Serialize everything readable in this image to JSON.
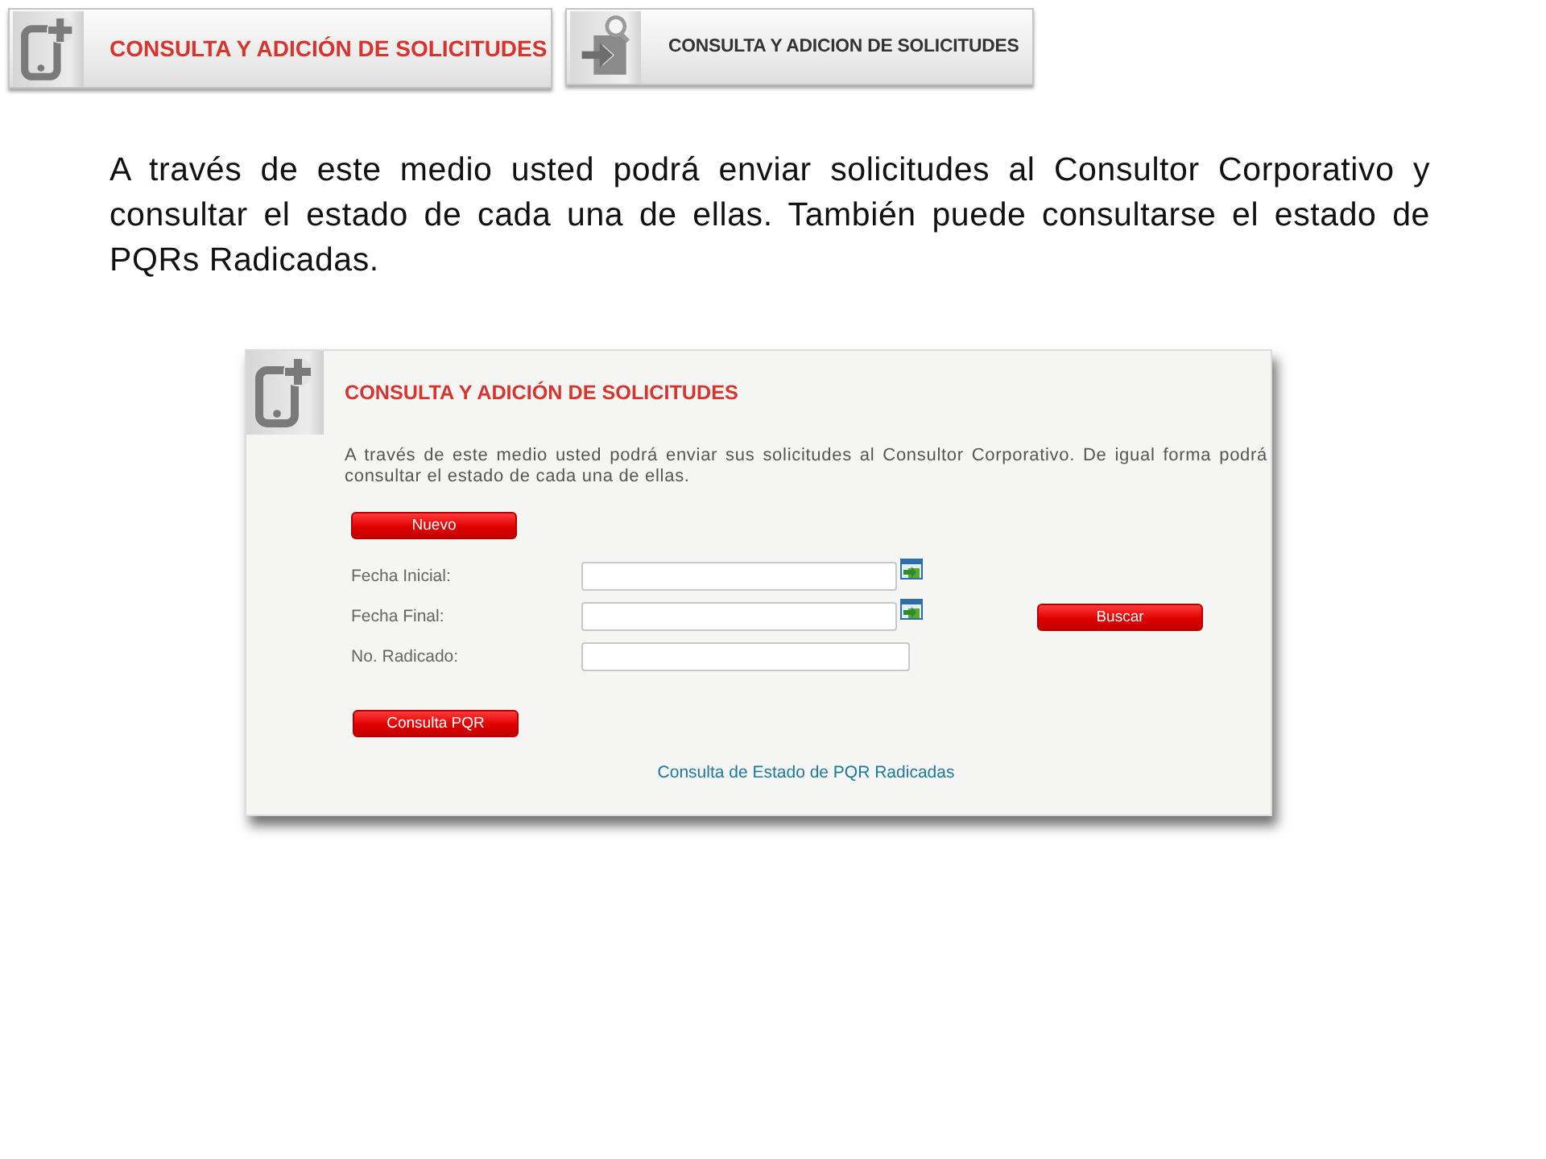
{
  "banners": [
    {
      "kind": "add",
      "title": "CONSULTA Y ADICIÓN DE SOLICITUDES"
    },
    {
      "kind": "search",
      "title": "CONSULTA Y ADICION DE SOLICITUDES"
    }
  ],
  "intro": "A través de este medio usted podrá enviar solicitudes al Consultor Corporativo y consultar el estado de cada una de ellas. También puede consultarse el estado de PQRs Radicadas.",
  "screenshot": {
    "title": "CONSULTA Y ADICIÓN DE SOLICITUDES",
    "description": "A través de este medio usted podrá enviar sus solicitudes al Consultor Corporativo. De igual forma podrá consultar el estado de cada una de ellas.",
    "new_button": "Nuevo",
    "fields": [
      {
        "label": "Fecha Inicial:",
        "kind": "date"
      },
      {
        "label": "Fecha Final:",
        "kind": "date"
      },
      {
        "label": "No. Radicado:",
        "kind": "text"
      }
    ],
    "search_button": "Buscar",
    "pqr_button": "Consulta PQR",
    "link": "Consulta de Estado de PQR Radicadas"
  }
}
